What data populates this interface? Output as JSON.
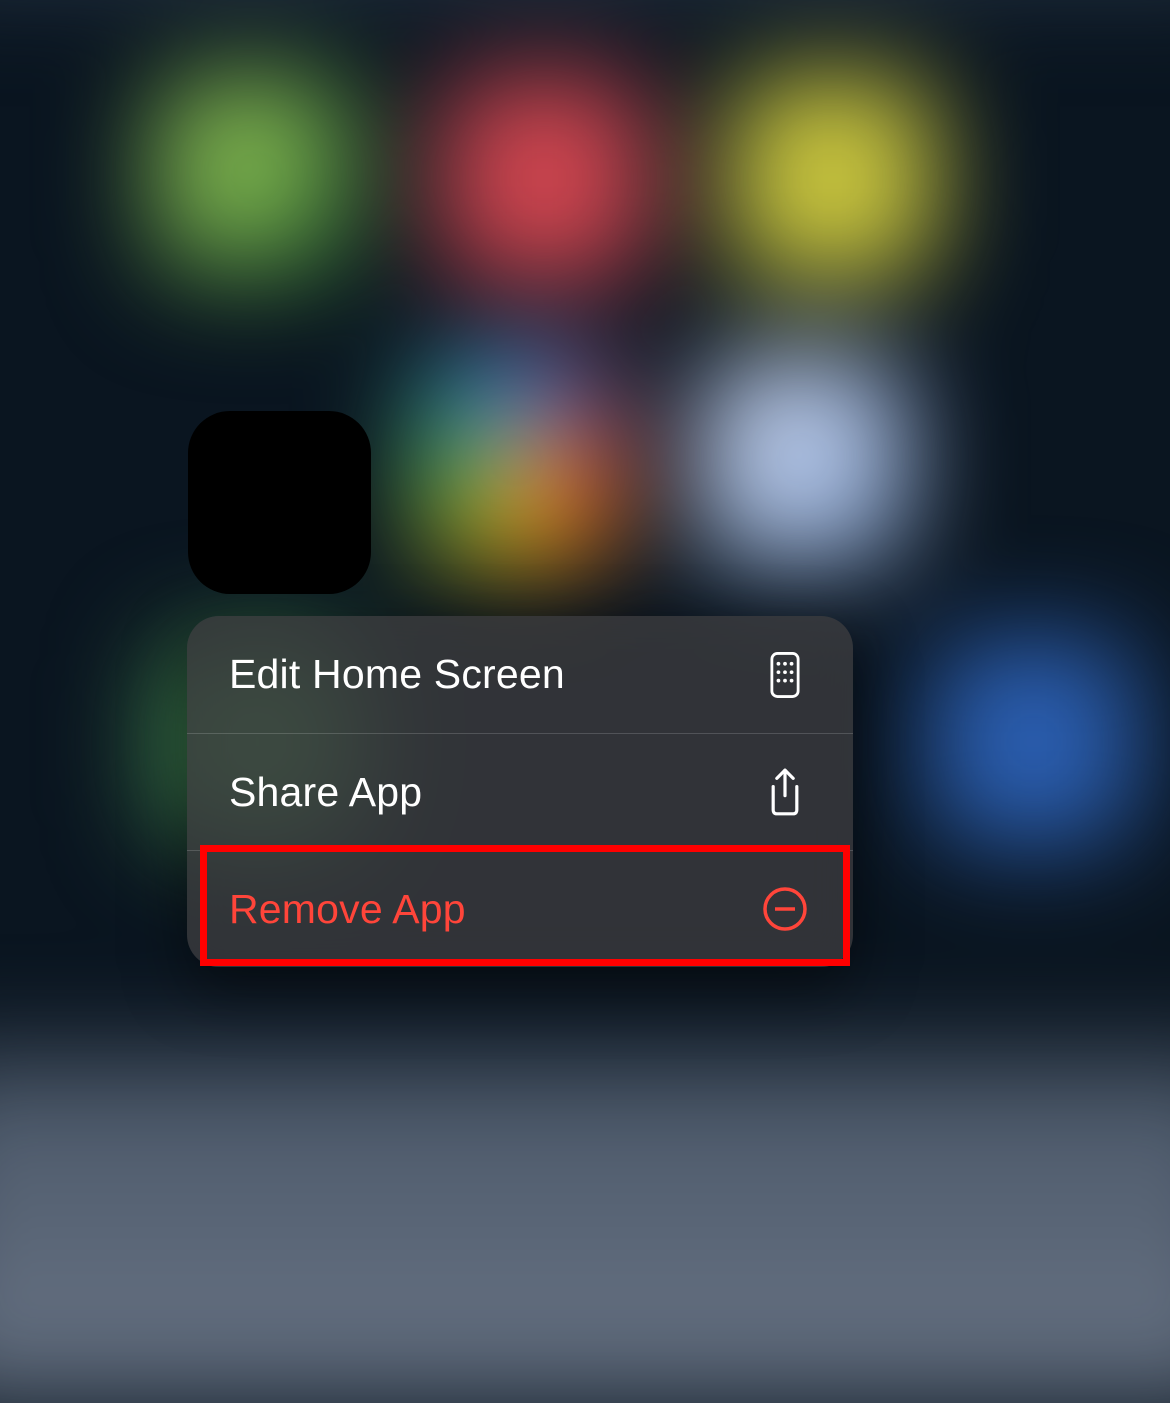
{
  "context_menu": {
    "items": [
      {
        "label": "Edit Home Screen",
        "icon": "phone-grid-icon",
        "destructive": false
      },
      {
        "label": "Share App",
        "icon": "share-icon",
        "destructive": false
      },
      {
        "label": "Remove App",
        "icon": "remove-icon",
        "destructive": true
      }
    ]
  },
  "colors": {
    "destructive": "#ff453a",
    "text": "#ffffff",
    "highlight_border": "#ff0000"
  }
}
